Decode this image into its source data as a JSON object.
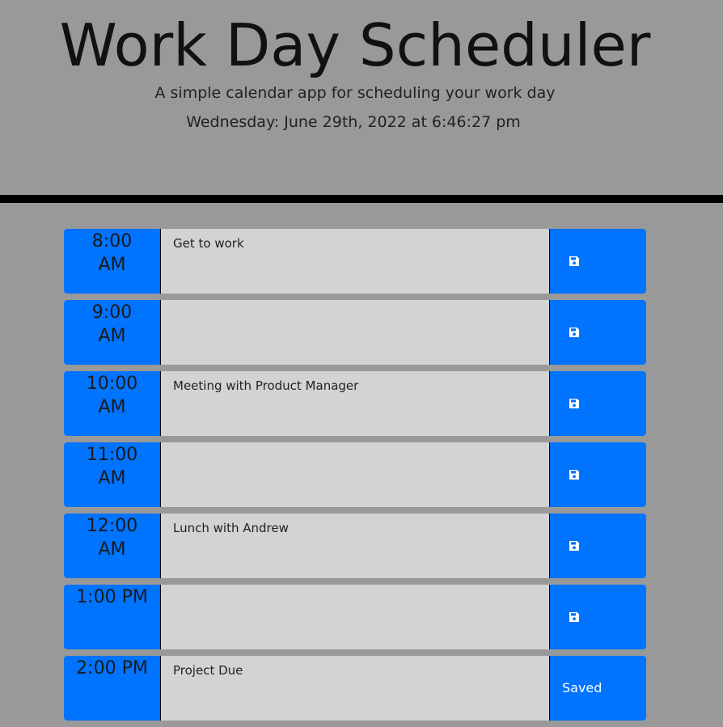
{
  "header": {
    "title": "Work Day Scheduler",
    "subtitle": "A simple calendar app for scheduling your work day",
    "current_day": "Wednesday: June 29th, 2022 at 6:46:27 pm"
  },
  "colors": {
    "background": "#999999",
    "divider": "#000000",
    "hour_block": "#0073ff",
    "save_button": "#0073ff",
    "textarea": "#d3d3d3"
  },
  "timeblocks": [
    {
      "hour_line1": "8:00",
      "hour_line2": "AM",
      "text": "Get to work",
      "button": {
        "icon": "floppy-disk-icon",
        "label": ""
      }
    },
    {
      "hour_line1": "9:00",
      "hour_line2": "AM",
      "text": "",
      "button": {
        "icon": "floppy-disk-icon",
        "label": ""
      }
    },
    {
      "hour_line1": "10:00",
      "hour_line2": "AM",
      "text": "Meeting with Product Manager",
      "button": {
        "icon": "floppy-disk-icon",
        "label": ""
      }
    },
    {
      "hour_line1": "11:00",
      "hour_line2": "AM",
      "text": "",
      "button": {
        "icon": "floppy-disk-icon",
        "label": ""
      }
    },
    {
      "hour_line1": "12:00",
      "hour_line2": "AM",
      "text": "Lunch with Andrew",
      "button": {
        "icon": "floppy-disk-icon",
        "label": ""
      }
    },
    {
      "hour_line1": "1:00 PM",
      "hour_line2": "",
      "text": "",
      "button": {
        "icon": "floppy-disk-icon",
        "label": ""
      }
    },
    {
      "hour_line1": "2:00 PM",
      "hour_line2": "",
      "text": "Project Due",
      "button": {
        "icon": "",
        "label": "Saved"
      }
    }
  ]
}
